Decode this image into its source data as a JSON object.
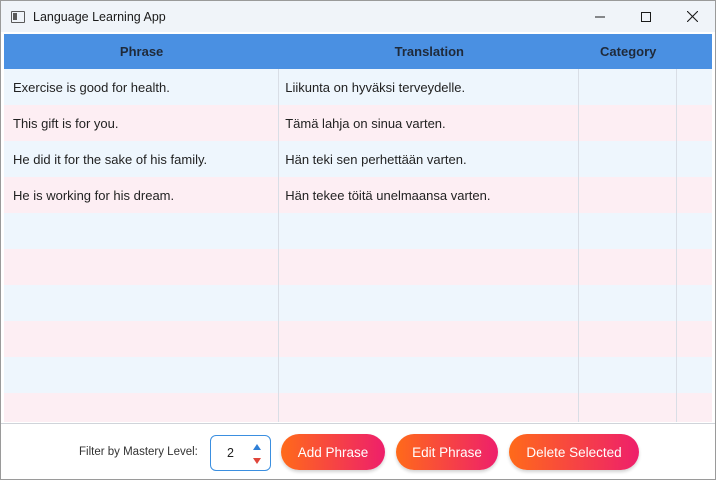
{
  "window": {
    "title": "Language Learning App",
    "icon": "app-window-icon",
    "controls": [
      "minimize-icon",
      "maximize-icon",
      "close-icon"
    ]
  },
  "table": {
    "headers": [
      "Phrase",
      "Translation",
      "Category",
      ""
    ],
    "header_color": "#4a90e2",
    "row_colors": [
      "#eef6fd",
      "#fdeef3"
    ],
    "rows": [
      {
        "phrase": "Exercise is good for health.",
        "translation": "Liikunta on hyväksi terveydelle.",
        "category": ""
      },
      {
        "phrase": "This gift is for you.",
        "translation": "Tämä lahja on sinua varten.",
        "category": ""
      },
      {
        "phrase": "He did it for the sake of his family.",
        "translation": "Hän teki sen perhettään varten.",
        "category": ""
      },
      {
        "phrase": "He is working for his dream.",
        "translation": "Hän tekee töitä unelmaansa varten.",
        "category": ""
      },
      {
        "phrase": "",
        "translation": "",
        "category": ""
      },
      {
        "phrase": "",
        "translation": "",
        "category": ""
      },
      {
        "phrase": "",
        "translation": "",
        "category": ""
      },
      {
        "phrase": "",
        "translation": "",
        "category": ""
      },
      {
        "phrase": "",
        "translation": "",
        "category": ""
      },
      {
        "phrase": "",
        "translation": "",
        "category": ""
      }
    ]
  },
  "footer": {
    "filter_label": "Filter by Mastery Level:",
    "mastery_level": "2",
    "buttons": {
      "add": "Add Phrase",
      "edit": "Edit Phrase",
      "delete": "Delete Selected"
    },
    "button_gradient": [
      "#ff6a1a",
      "#ee1f6b"
    ]
  }
}
